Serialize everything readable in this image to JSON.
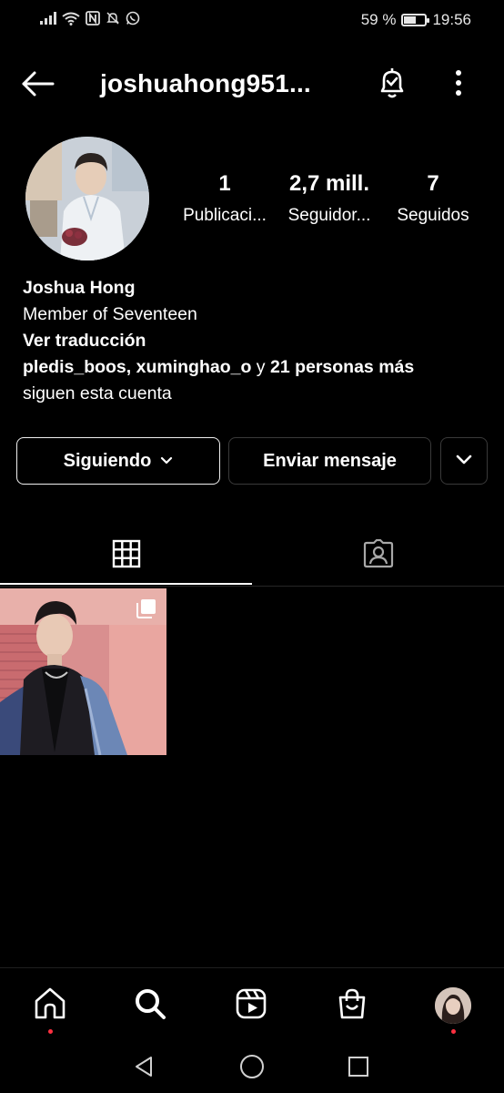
{
  "status_bar": {
    "battery_text": "59 %",
    "battery_level": 0.59,
    "time": "19:56",
    "icons": [
      "signal-icon",
      "wifi-icon",
      "nfc-icon",
      "mute-icon",
      "whatsapp-icon"
    ]
  },
  "header": {
    "username": "joshuahong951...",
    "back_icon": "arrow-left-icon",
    "notifications_icon": "bell-check-icon",
    "more_icon": "more-vertical-icon"
  },
  "profile": {
    "stats": [
      {
        "value": "1",
        "label": "Publicaci..."
      },
      {
        "value": "2,7 mill.",
        "label": "Seguidor..."
      },
      {
        "value": "7",
        "label": "Seguidos"
      }
    ],
    "name": "Joshua Hong",
    "bio": "Member of Seventeen",
    "translate": "Ver traducción",
    "followed_by": {
      "users": "pledis_boos, xuminghao_o",
      "connector": " y ",
      "others": "21 personas más",
      "suffix": "siguen esta cuenta"
    }
  },
  "buttons": {
    "following": "Siguiendo",
    "message": "Enviar mensaje"
  },
  "tabs": [
    {
      "name": "grid",
      "icon": "grid-icon",
      "active": true
    },
    {
      "name": "tagged",
      "icon": "tagged-icon",
      "active": false
    }
  ],
  "bottom_nav": [
    {
      "name": "home",
      "icon": "home-icon",
      "has_dot": true
    },
    {
      "name": "search",
      "icon": "search-icon",
      "has_dot": false
    },
    {
      "name": "reels",
      "icon": "reels-icon",
      "has_dot": false
    },
    {
      "name": "shop",
      "icon": "shop-icon",
      "has_dot": false
    },
    {
      "name": "profile",
      "icon": "avatar",
      "has_dot": true
    }
  ],
  "colors": {
    "background": "#000000",
    "text": "#ffffff",
    "notification_dot": "#ff3040",
    "border": "#3a3a3a"
  }
}
